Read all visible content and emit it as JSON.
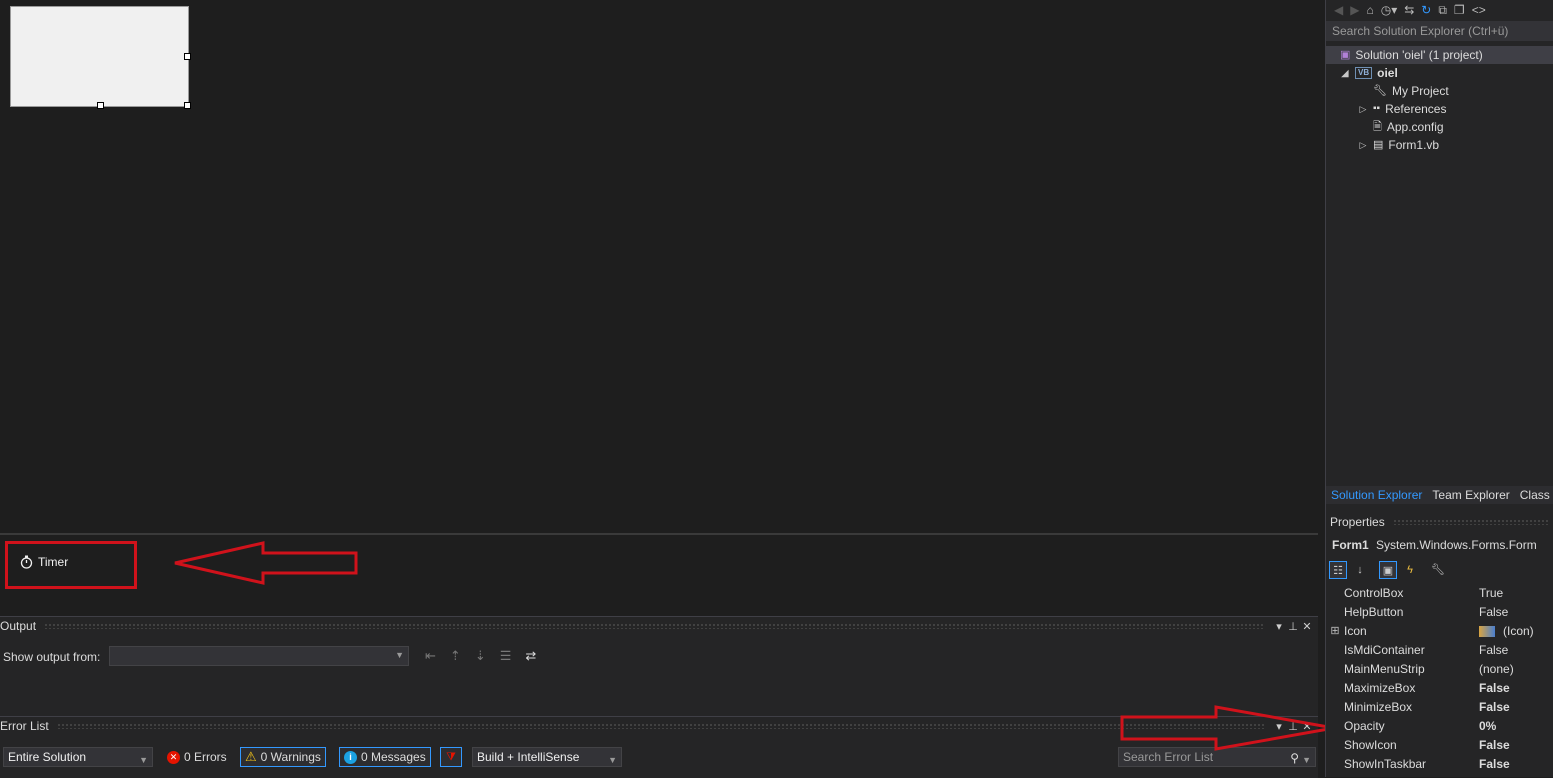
{
  "designer": {
    "component_tray": {
      "timer_label": "Timer"
    }
  },
  "output": {
    "title": "Output",
    "show_output_from_label": "Show output from:",
    "source_value": ""
  },
  "error_list": {
    "title": "Error List",
    "scope_value": "Entire Solution",
    "errors_label": "0 Errors",
    "warnings_label": "0 Warnings",
    "messages_label": "0 Messages",
    "build_filter_value": "Build + IntelliSense",
    "search_placeholder": "Search Error List"
  },
  "solution_explorer": {
    "search_placeholder": "Search Solution Explorer (Ctrl+ü)",
    "solution_label": "Solution 'oiel' (1 project)",
    "project_label": "oiel",
    "items": [
      {
        "label": "My Project",
        "icon": "wrench-icon"
      },
      {
        "label": "References",
        "icon": "references-icon"
      },
      {
        "label": "App.config",
        "icon": "config-file-icon"
      },
      {
        "label": "Form1.vb",
        "icon": "form-icon"
      }
    ],
    "tabs": [
      "Solution Explorer",
      "Team Explorer",
      "Class Vi"
    ]
  },
  "properties": {
    "title": "Properties",
    "object_name": "Form1",
    "object_type": "System.Windows.Forms.Form",
    "rows": [
      {
        "name": "ControlBox",
        "value": "True"
      },
      {
        "name": "HelpButton",
        "value": "False"
      },
      {
        "name": "Icon",
        "value": "(Icon)"
      },
      {
        "name": "IsMdiContainer",
        "value": "False"
      },
      {
        "name": "MainMenuStrip",
        "value": "(none)"
      },
      {
        "name": "MaximizeBox",
        "value": "False"
      },
      {
        "name": "MinimizeBox",
        "value": "False"
      },
      {
        "name": "Opacity",
        "value": "0%"
      },
      {
        "name": "ShowIcon",
        "value": "False"
      },
      {
        "name": "ShowInTaskbar",
        "value": "False"
      }
    ]
  },
  "colors": {
    "annotation_red": "#d0121b",
    "accent_blue": "#3399ff"
  }
}
